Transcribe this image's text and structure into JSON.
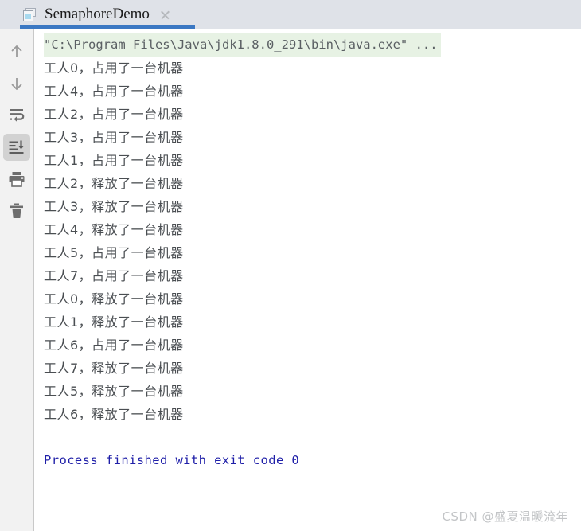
{
  "window": {
    "accent_color": "#3b78c3",
    "tabbar_bg": "#dfe2e8",
    "toolbar_bg": "#f2f2f2",
    "console_bg": "#ffffff"
  },
  "tab": {
    "title": "SemaphoreDemo",
    "icon": "run-configuration-icon",
    "close_label": "×",
    "selected": true
  },
  "toolbar": {
    "items": [
      {
        "name": "up-arrow-icon",
        "label": "Up",
        "selected": false
      },
      {
        "name": "down-arrow-icon",
        "label": "Down",
        "selected": false
      },
      {
        "name": "soft-wrap-icon",
        "label": "Soft-Wrap",
        "selected": false
      },
      {
        "name": "scroll-to-end-icon",
        "label": "Scroll to End",
        "selected": true
      },
      {
        "name": "print-icon",
        "label": "Print",
        "selected": false
      },
      {
        "name": "trash-icon",
        "label": "Clear All",
        "selected": false
      }
    ]
  },
  "console": {
    "command_line": "\"C:\\Program Files\\Java\\jdk1.8.0_291\\bin\\java.exe\" ...",
    "command_bg": "#e7f2e4",
    "lines": [
      "工人0，占用了一台机器",
      "工人4，占用了一台机器",
      "工人2，占用了一台机器",
      "工人3，占用了一台机器",
      "工人1，占用了一台机器",
      "工人2，释放了一台机器",
      "工人3，释放了一台机器",
      "工人4，释放了一台机器",
      "工人5，占用了一台机器",
      "工人7，占用了一台机器",
      "工人0，释放了一台机器",
      "工人1，释放了一台机器",
      "工人6，占用了一台机器",
      "工人7，释放了一台机器",
      "工人5，释放了一台机器",
      "工人6，释放了一台机器"
    ],
    "exit_message": "Process finished with exit code 0",
    "exit_color": "#1f1fa8"
  },
  "watermark": {
    "text": "CSDN @盛夏温暖流年"
  }
}
